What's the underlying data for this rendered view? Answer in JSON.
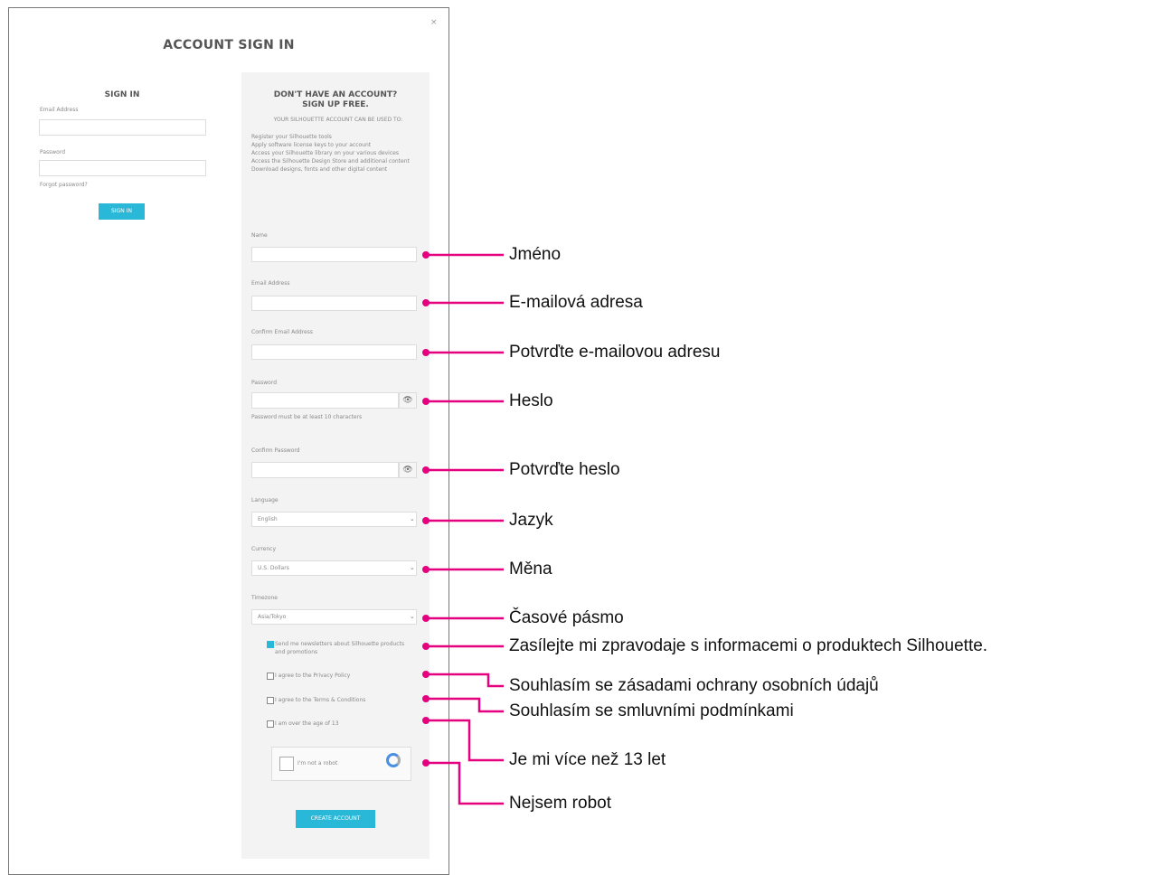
{
  "dialog": {
    "title": "ACCOUNT SIGN IN",
    "close": "×"
  },
  "signin": {
    "heading": "SIGN IN",
    "email_label": "Email Address",
    "password_label": "Password",
    "forgot": "Forgot password?",
    "button": "SIGN IN"
  },
  "signup": {
    "heading_line1": "DON'T HAVE AN ACCOUNT?",
    "heading_line2": "SIGN UP FREE.",
    "subheading": "YOUR SILHOUETTE ACCOUNT CAN BE USED TO:",
    "bullets": [
      "Register your Silhouette tools",
      "Apply software license keys to your account",
      "Access your Silhouette library on your various devices",
      "Access the Silhouette Design Store and additional content",
      "Download designs, fonts and other digital content"
    ],
    "name_label": "Name",
    "email_label": "Email Address",
    "confirm_email_label": "Confirm Email Address",
    "password_label": "Password",
    "password_hint": "Password must be at least 10 characters",
    "confirm_password_label": "Confirm Password",
    "language_label": "Language",
    "language_value": "English",
    "currency_label": "Currency",
    "currency_value": "U.S. Dollars",
    "timezone_label": "Timezone",
    "timezone_value": "Asia/Tokyo",
    "newsletter_text": "Send me newsletters about Silhouette products and promotions",
    "privacy_text": "I agree to the Privacy Policy",
    "terms_text": "I agree to the Terms & Conditions",
    "age_text": "I am over the age of 13",
    "captcha_text": "I'm not a robot",
    "create_button": "CREATE ACCOUNT"
  },
  "callouts": {
    "name": "Jméno",
    "email": "E-mailová adresa",
    "confirm_email": "Potvrďte e-mailovou adresu",
    "password": "Heslo",
    "confirm_password": "Potvrďte heslo",
    "language": "Jazyk",
    "currency": "Měna",
    "timezone": "Časové pásmo",
    "newsletter": "Zasílejte mi zpravodaje s informacemi o produktech Silhouette.",
    "privacy": "Souhlasím se zásadami ochrany osobních údajů",
    "terms": "Souhlasím se smluvními podmínkami",
    "age": "Je mi více než 13 let",
    "robot": "Nejsem robot"
  },
  "colors": {
    "accent": "#29b8d8",
    "callout_line": "#e4007f"
  }
}
